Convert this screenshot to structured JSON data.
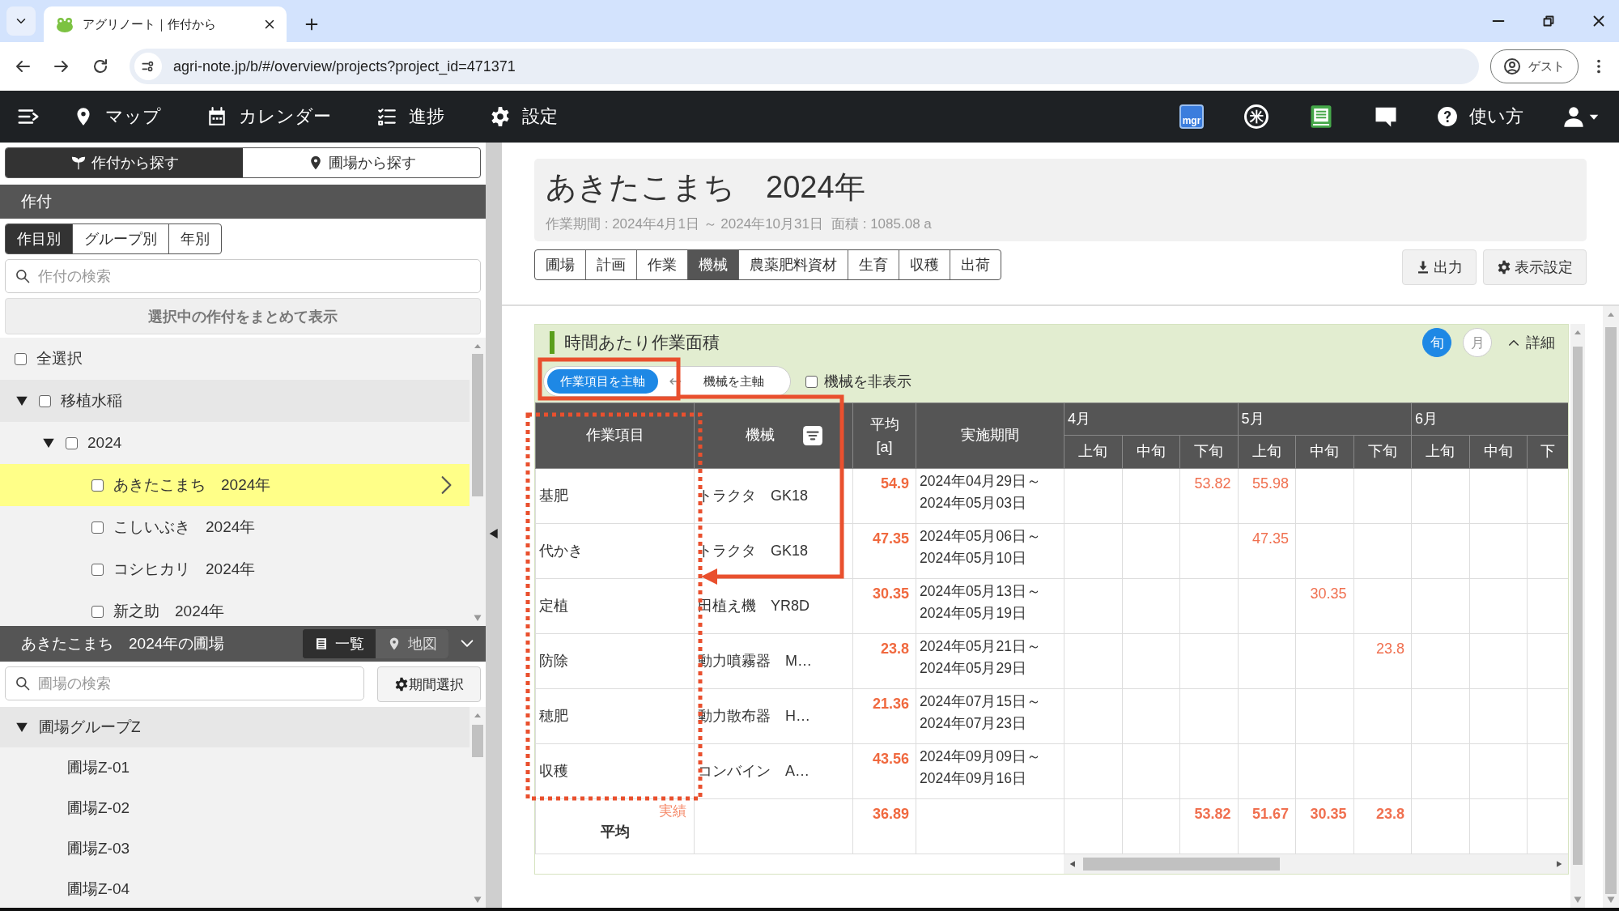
{
  "browser": {
    "tab_title": "アグリノート｜作付から",
    "url": "agri-note.jp/b/#/overview/projects?project_id=471371",
    "profile": "ゲスト"
  },
  "nav": {
    "left": [
      {
        "kind": "menu"
      },
      {
        "kind": "map",
        "label": "マップ"
      },
      {
        "kind": "calendar",
        "label": "カレンダー"
      },
      {
        "kind": "progress",
        "label": "進捗"
      },
      {
        "kind": "settings",
        "label": "設定"
      }
    ],
    "right": [
      {
        "kind": "mgr",
        "label": "mgr"
      },
      {
        "kind": "rice",
        "label": "米"
      },
      {
        "kind": "book"
      },
      {
        "kind": "chat"
      },
      {
        "kind": "help",
        "label": "使い方"
      },
      {
        "kind": "user"
      }
    ]
  },
  "search_mode": [
    {
      "label": "作付から探す",
      "selected": true
    },
    {
      "label": "圃場から探す",
      "selected": false
    }
  ],
  "crop_panel": {
    "title": "作付",
    "tabs": [
      {
        "label": "作目別",
        "selected": true
      },
      {
        "label": "グループ別",
        "selected": false
      },
      {
        "label": "年別",
        "selected": false
      }
    ],
    "search": {
      "placeholder": "作付の検索"
    },
    "bulk_button": "選択中の作付をまとめて表示",
    "select_all": {
      "label": "全選択",
      "checked": false
    },
    "tree": [
      {
        "label": "移植水稲",
        "checked": false,
        "expanded": true,
        "children": [
          {
            "label": "2024",
            "checked": false,
            "expanded": true,
            "children": [
              {
                "label": "あきたこまち　2024年",
                "checked": false,
                "selected": true
              },
              {
                "label": "こしいぶき　2024年",
                "checked": false,
                "selected": false
              },
              {
                "label": "コシヒカリ　2024年",
                "checked": false,
                "selected": false
              },
              {
                "label": "新之助　2024年",
                "checked": false,
                "selected": false
              }
            ]
          }
        ]
      }
    ]
  },
  "field_panel": {
    "title": "あきたこまち　2024年の圃場",
    "views": [
      {
        "label": "一覧",
        "selected": true
      },
      {
        "label": "地図",
        "selected": false
      }
    ],
    "search": {
      "placeholder": "圃場の検索"
    },
    "period_button": "期間選択",
    "tree": [
      {
        "label": "圃場グループZ",
        "expanded": true,
        "children": [
          {
            "label": "圃場Z-01"
          },
          {
            "label": "圃場Z-02"
          },
          {
            "label": "圃場Z-03"
          },
          {
            "label": "圃場Z-04"
          }
        ]
      }
    ]
  },
  "project": {
    "title": "あきたこまち　2024年",
    "period": "作業期間 : 2024年4月1日 ～ 2024年10月31日",
    "area": "面積 : 1085.08 a"
  },
  "tabs": [
    {
      "label": "圃場",
      "selected": false
    },
    {
      "label": "計画",
      "selected": false
    },
    {
      "label": "作業",
      "selected": false
    },
    {
      "label": "機械",
      "selected": true
    },
    {
      "label": "農薬肥料資材",
      "selected": false
    },
    {
      "label": "生育",
      "selected": false
    },
    {
      "label": "収穫",
      "selected": false
    },
    {
      "label": "出荷",
      "selected": false
    }
  ],
  "actions": [
    {
      "label": "出力"
    },
    {
      "label": "表示設定"
    }
  ],
  "section": {
    "title": "時間あたり作業面積",
    "granularity": [
      {
        "label": "旬",
        "selected": true
      },
      {
        "label": "月",
        "selected": false
      }
    ],
    "details": {
      "label": "詳細",
      "expanded": true
    },
    "axis": [
      {
        "label": "作業項目を主軸",
        "selected": true
      },
      {
        "label": "機械を主軸",
        "selected": false
      }
    ],
    "hide_machines": {
      "label": "機械を非表示",
      "checked": false
    }
  },
  "table": {
    "columns": [
      {
        "label": "作業項目"
      },
      {
        "label": "機械",
        "filter": true
      },
      {
        "label": "平均",
        "unit": "[a]"
      },
      {
        "label": "実施期間"
      }
    ],
    "months": [
      {
        "label": "4月",
        "periods": [
          "上旬",
          "中旬",
          "下旬"
        ]
      },
      {
        "label": "5月",
        "periods": [
          "上旬",
          "中旬",
          "下旬"
        ]
      },
      {
        "label": "6月",
        "periods": [
          "上旬",
          "中旬",
          "下"
        ]
      }
    ],
    "rows": [
      {
        "task": "基肥",
        "machine": "トラクタ　GK18",
        "average": "54.9",
        "start": "2024年04月29日～",
        "end": "2024年05月03日",
        "cells": [
          null,
          null,
          "53.82",
          "55.98",
          null,
          null,
          null,
          null,
          null
        ]
      },
      {
        "task": "代かき",
        "machine": "トラクタ　GK18",
        "average": "47.35",
        "start": "2024年05月06日～",
        "end": "2024年05月10日",
        "cells": [
          null,
          null,
          null,
          "47.35",
          null,
          null,
          null,
          null,
          null
        ]
      },
      {
        "task": "定植",
        "machine": "田植え機　YR8D",
        "average": "30.35",
        "start": "2024年05月13日～",
        "end": "2024年05月19日",
        "cells": [
          null,
          null,
          null,
          null,
          "30.35",
          null,
          null,
          null,
          null
        ]
      },
      {
        "task": "防除",
        "machine": "動力噴霧器　M…",
        "average": "23.8",
        "start": "2024年05月21日～",
        "end": "2024年05月29日",
        "cells": [
          null,
          null,
          null,
          null,
          null,
          "23.8",
          null,
          null,
          null
        ]
      },
      {
        "task": "穂肥",
        "machine": "動力散布器　H…",
        "average": "21.36",
        "start": "2024年07月15日～",
        "end": "2024年07月23日",
        "cells": [
          null,
          null,
          null,
          null,
          null,
          null,
          null,
          null,
          null
        ]
      },
      {
        "task": "収穫",
        "machine": "コンバイン　A…",
        "average": "43.56",
        "start": "2024年09月09日～",
        "end": "2024年09月16日",
        "cells": [
          null,
          null,
          null,
          null,
          null,
          null,
          null,
          null,
          null
        ]
      }
    ],
    "summary": {
      "label": "平均",
      "average": "36.89",
      "cells": [
        null,
        null,
        "53.82",
        "51.67",
        "30.35",
        "23.8",
        null,
        null,
        null
      ]
    }
  },
  "annotations": [
    {
      "kind": "frame"
    },
    {
      "kind": "arrow"
    },
    {
      "kind": "dotted-frame"
    },
    {
      "kind": "label",
      "text": "実績"
    }
  ]
}
